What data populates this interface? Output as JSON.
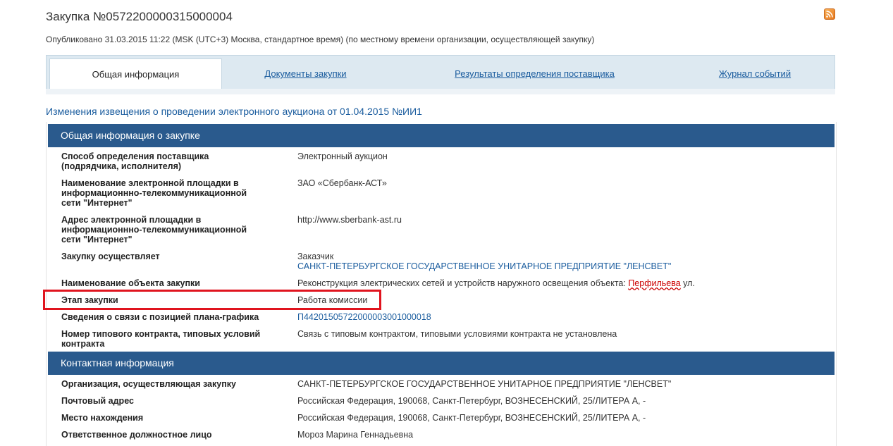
{
  "header": {
    "title": "Закупка №0572200000315000004",
    "published": "Опубликовано 31.03.2015 11:22 (MSK (UTC+3) Москва, стандартное время) (по местному времени организации, осуществляющей закупку)",
    "rss_icon": "rss-icon"
  },
  "tabs": [
    {
      "label": "Общая информация",
      "active": true
    },
    {
      "label": "Документы закупки",
      "active": false
    },
    {
      "label": "Результаты определения поставщика",
      "active": false
    },
    {
      "label": "Журнал событий",
      "active": false
    }
  ],
  "change_link": "Изменения извещения о проведении электронного аукциона от 01.04.2015 №ИИ1",
  "sections": {
    "general": {
      "heading": "Общая информация о закупке",
      "rows": [
        {
          "label": "Способ определения поставщика (подрядчика, исполнителя)",
          "value": "Электронный аукцион"
        },
        {
          "label": "Наименование электронной площадки в информационнно-телекоммуникационной сети \"Интернет\"",
          "value": "ЗАО «Сбербанк-АСТ»"
        },
        {
          "label": "Адрес электронной площадки в информационнно-телекоммуникационной сети \"Интернет\"",
          "value": "http://www.sberbank-ast.ru"
        },
        {
          "label": "Закупку осуществляет",
          "value": "Заказчик",
          "value_link": "САНКТ-ПЕТЕРБУРГСКОЕ ГОСУДАРСТВЕННОЕ УНИТАРНОЕ ПРЕДПРИЯТИЕ \"ЛЕНСВЕТ\""
        },
        {
          "label": "Наименование объекта закупки",
          "value_pre": "Реконструкция электрических сетей и устройств наружного освещения объекта: ",
          "value_spell": "Перфильева",
          "value_post": " ул."
        },
        {
          "label": "Этап закупки",
          "value": "Работа комиссии"
        },
        {
          "label": "Сведения о связи с позицией плана-графика",
          "value_link": "П44201505722000003001000018"
        },
        {
          "label": "Номер типового контракта, типовых условий контракта",
          "value": "Связь с типовым контрактом, типовыми условиями контракта не установлена"
        }
      ]
    },
    "contact": {
      "heading": "Контактная информация",
      "rows": [
        {
          "label": "Организация, осуществляющая закупку",
          "value": "САНКТ-ПЕТЕРБУРГСКОЕ ГОСУДАРСТВЕННОЕ УНИТАРНОЕ ПРЕДПРИЯТИЕ \"ЛЕНСВЕТ\""
        },
        {
          "label": "Почтовый адрес",
          "value": "Российская Федерация, 190068, Санкт-Петербург, ВОЗНЕСЕНСКИЙ, 25/ЛИТЕРА А, -"
        },
        {
          "label": "Место нахождения",
          "value": "Российская Федерация, 190068, Санкт-Петербург, ВОЗНЕСЕНСКИЙ, 25/ЛИТЕРА А, -"
        },
        {
          "label": "Ответственное должностное лицо",
          "value": "Мороз Марина Геннадьевна"
        }
      ]
    }
  },
  "colors": {
    "section_header": "#2a5a8d",
    "link": "#1a5c9e",
    "highlight": "#e0141e"
  }
}
